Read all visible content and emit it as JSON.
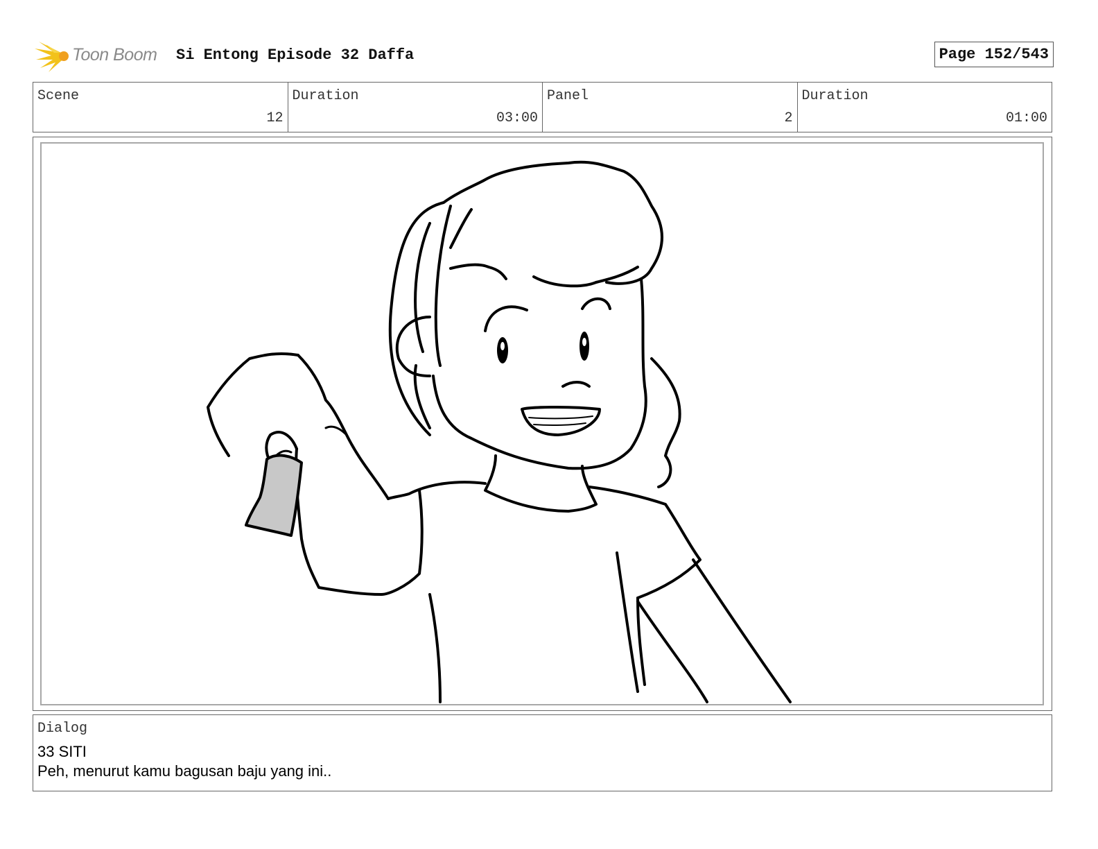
{
  "header": {
    "logo_text": "Toon Boom",
    "logo_icon": "starburst-logo-icon",
    "project_title": "Si Entong Episode 32 Daffa",
    "page_label": "Page 152/543"
  },
  "info": {
    "scene_label": "Scene",
    "scene_value": "12",
    "scene_duration_label": "Duration",
    "scene_duration_value": "03:00",
    "panel_label": "Panel",
    "panel_value": "2",
    "panel_duration_label": "Duration",
    "panel_duration_value": "01:00"
  },
  "dialog": {
    "label": "Dialog",
    "line1": "33 SITI",
    "line2": "Peh, menurut kamu bagusan baju yang ini.."
  },
  "colors": {
    "logo_yellow": "#f2c21b",
    "logo_orange": "#f0a020",
    "fabric_gray": "#c8c8c8"
  }
}
